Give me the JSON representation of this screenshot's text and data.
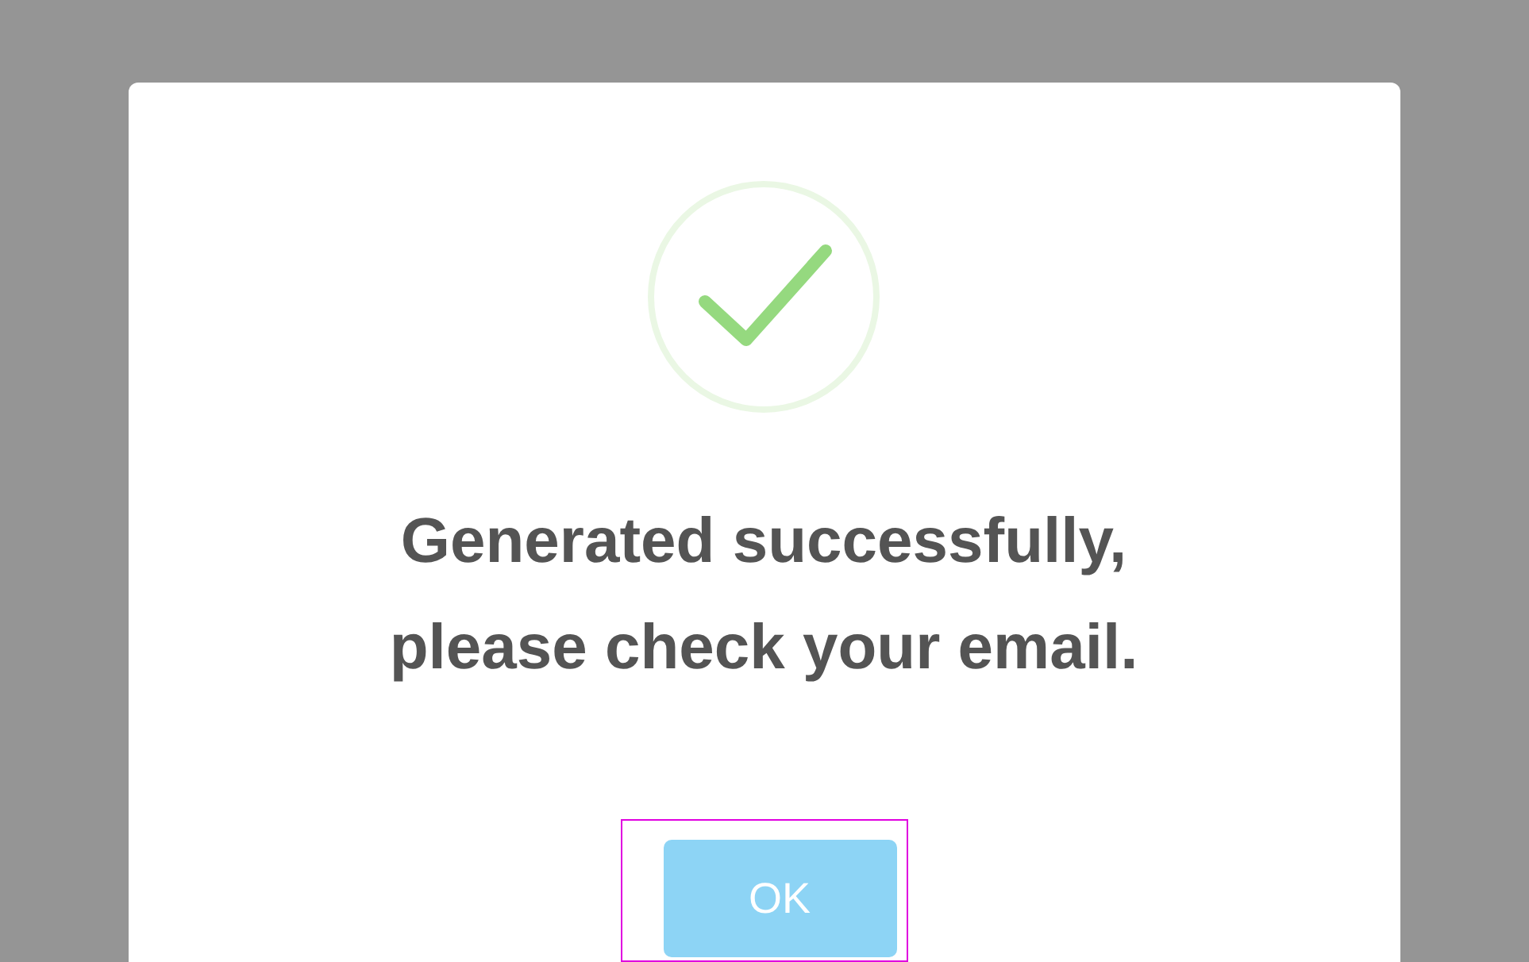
{
  "dialog": {
    "message": "Generated successfully,\nplease check your email.",
    "button": {
      "label": "OK",
      "focused": true
    }
  }
}
